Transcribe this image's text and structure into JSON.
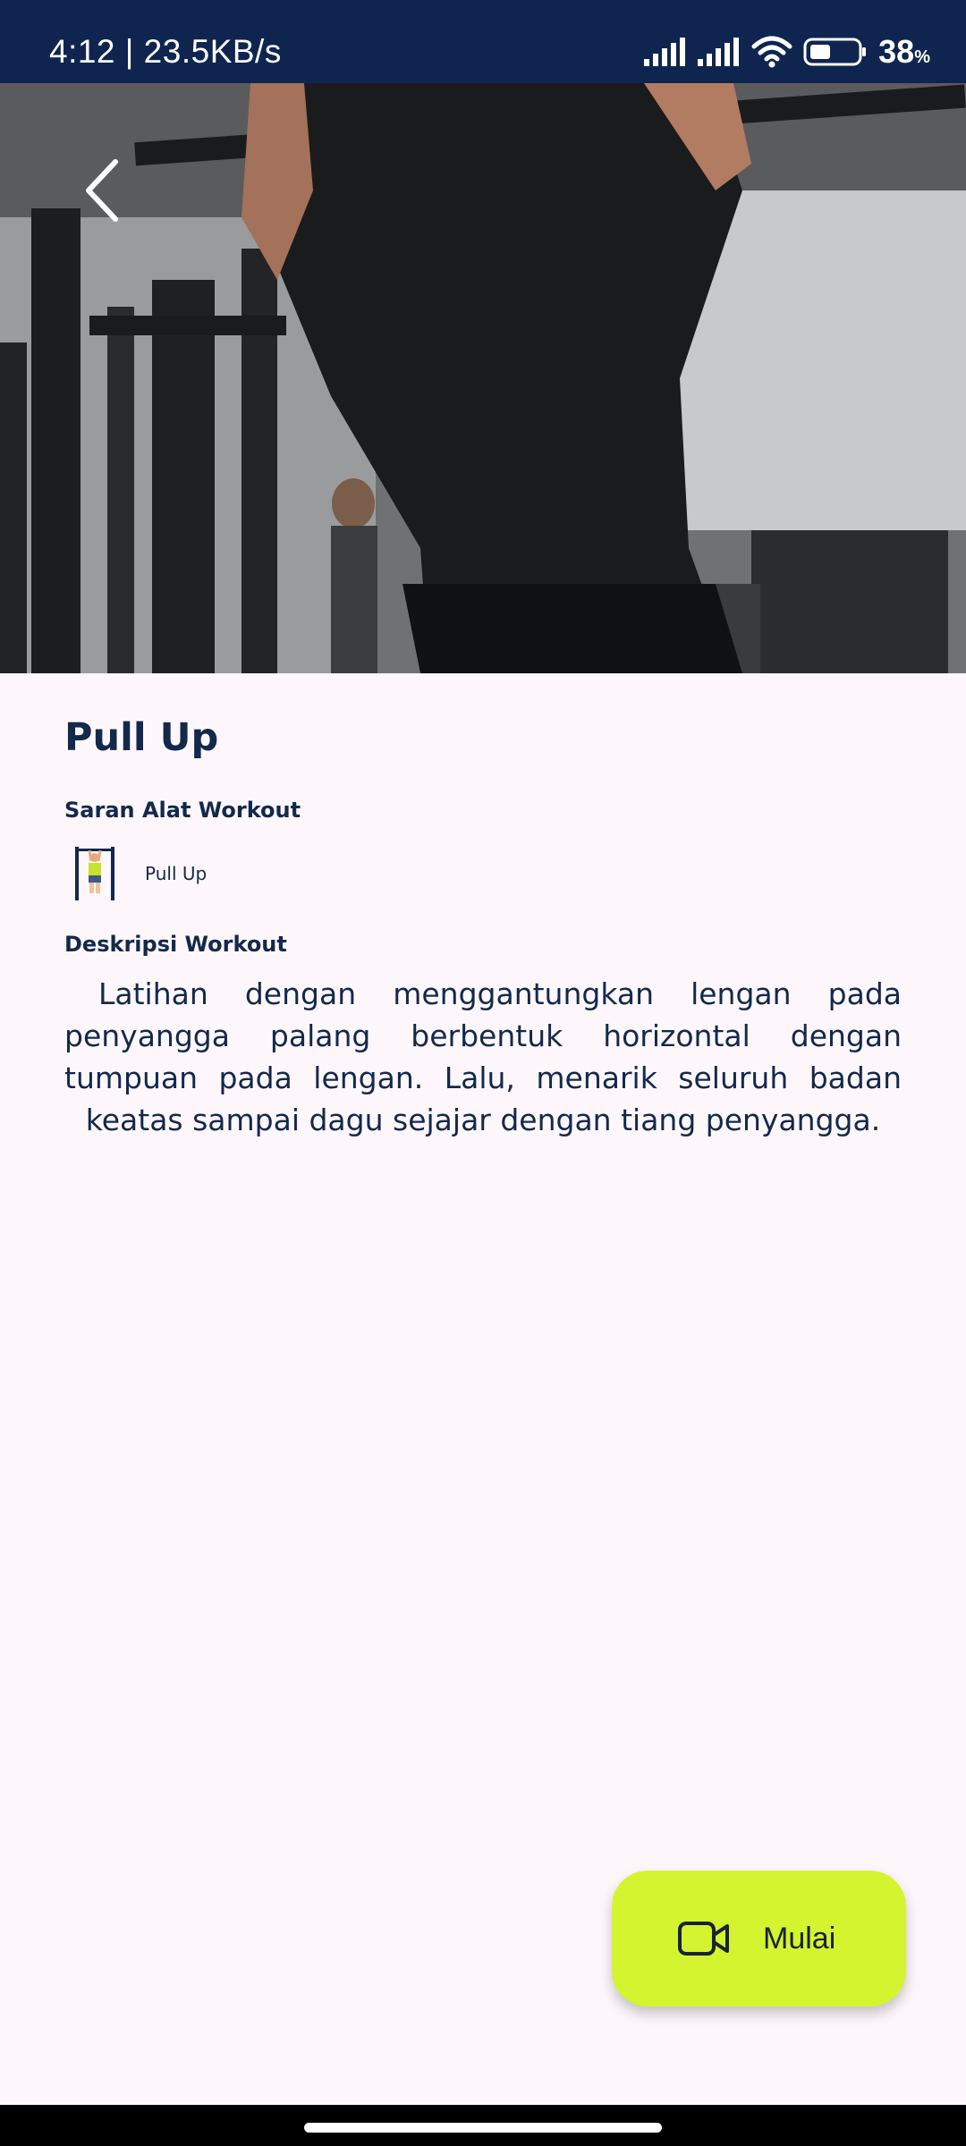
{
  "status_bar": {
    "time_speed": "4:12 | 23.5KB/s",
    "battery_value": "38",
    "battery_unit": "%"
  },
  "hero": {
    "back_icon": "chevron-left-icon"
  },
  "workout": {
    "title": "Pull Up",
    "equipment_heading": "Saran Alat Workout",
    "equipment": [
      {
        "label": "Pull Up",
        "icon": "pull-up-bar-icon"
      }
    ],
    "description_heading": "Deskripsi Workout",
    "description": "Latihan dengan menggantungkan lengan pada penyangga palang berbentuk horizontal dengan tumpuan pada lengan. Lalu, menarik seluruh badan keatas sampai dagu sejajar dengan tiang penyangga."
  },
  "fab": {
    "label": "Mulai",
    "icon": "video-camera-icon",
    "color": "#d4f42f"
  },
  "colors": {
    "status_bar": "#0f2550",
    "text_primary": "#13294b",
    "background": "#fdf7fc"
  }
}
